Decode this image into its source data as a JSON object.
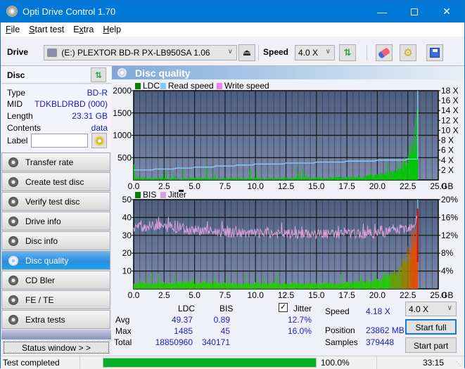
{
  "window": {
    "title": "Opti Drive Control 1.70",
    "controls": [
      "minimize",
      "maximize",
      "close"
    ]
  },
  "menu": [
    {
      "label": "File",
      "accel": "F"
    },
    {
      "label": "Start test",
      "accel": "S"
    },
    {
      "label": "Extra",
      "accel": "x"
    },
    {
      "label": "Help",
      "accel": "H"
    }
  ],
  "toolbar": {
    "drive_label": "Drive",
    "drive_value": "(E:)  PLEXTOR BD-R  PX-LB950SA 1.06",
    "speed_label": "Speed",
    "speed_value": "4.0 X",
    "icons": [
      "eject-icon",
      "refresh-icon",
      "eraser-icon",
      "settings-icon",
      "save-icon"
    ]
  },
  "disc": {
    "header": "Disc",
    "rows": [
      {
        "label": "Type",
        "value": "BD-R"
      },
      {
        "label": "MID",
        "value": "TDKBLDRBD (000)"
      },
      {
        "label": "Length",
        "value": "23.31 GB"
      },
      {
        "label": "Contents",
        "value": "data"
      }
    ],
    "label_field_label": "Label",
    "label_field_value": ""
  },
  "nav": [
    {
      "label": "Transfer rate",
      "active": false
    },
    {
      "label": "Create test disc",
      "active": false
    },
    {
      "label": "Verify test disc",
      "active": false
    },
    {
      "label": "Drive info",
      "active": false
    },
    {
      "label": "Disc info",
      "active": false
    },
    {
      "label": "Disc quality",
      "active": true
    },
    {
      "label": "CD Bler",
      "active": false
    },
    {
      "label": "FE / TE",
      "active": false
    },
    {
      "label": "Extra tests",
      "active": false
    }
  ],
  "status_window_button": "Status window > >",
  "panel_title": "Disc quality",
  "chart_data": [
    {
      "type": "area",
      "title": "",
      "legend": [
        "LDC",
        "Read speed",
        "Write speed"
      ],
      "legend_colors": [
        "#008000",
        "#80c8f8",
        "#f080f0"
      ],
      "legend_placement": "top-left",
      "xlabel": "GB",
      "ylabel": "",
      "xlim": [
        0,
        25
      ],
      "ylim": [
        0,
        2000
      ],
      "y2lim": [
        0,
        18
      ],
      "x_ticks": [
        "0.0",
        "2.5",
        "5.0",
        "7.5",
        "10.0",
        "12.5",
        "15.0",
        "17.5",
        "20.0",
        "22.5",
        "25.0"
      ],
      "y_ticks": [
        "500",
        "1000",
        "1500",
        "2000"
      ],
      "y2_ticks": [
        "2 X",
        "4 X",
        "6 X",
        "8 X",
        "10 X",
        "12 X",
        "14 X",
        "16 X",
        "18 X"
      ],
      "grid": true,
      "series": [
        {
          "name": "LDC",
          "x": [
            0,
            0.5,
            1,
            2,
            3,
            4,
            5,
            6,
            7,
            8,
            9,
            10,
            11,
            12,
            13,
            14,
            15,
            16,
            17,
            18,
            19,
            20,
            20.5,
            21,
            21.5,
            22,
            22.3,
            22.6,
            22.9,
            23.1,
            23.31
          ],
          "y": [
            60,
            45,
            40,
            38,
            36,
            38,
            40,
            36,
            35,
            36,
            38,
            40,
            38,
            40,
            42,
            45,
            48,
            50,
            55,
            62,
            75,
            100,
            130,
            170,
            220,
            300,
            420,
            600,
            850,
            1100,
            1485
          ]
        },
        {
          "name": "Read speed",
          "x": [
            0,
            1,
            2.5,
            5,
            7.5,
            10,
            12.5,
            15,
            17.5,
            20,
            22.5,
            23.31
          ],
          "y": [
            1.9,
            2.0,
            2.2,
            2.5,
            2.8,
            3.1,
            3.3,
            3.5,
            3.7,
            3.9,
            4.1,
            4.18
          ]
        }
      ]
    },
    {
      "type": "area",
      "title": "",
      "legend": [
        "BIS",
        "Jitter"
      ],
      "legend_colors": [
        "#008000",
        "#d8a0d8"
      ],
      "legend_placement": "top-left",
      "xlabel": "GB",
      "ylabel": "",
      "xlim": [
        0,
        25
      ],
      "ylim": [
        0,
        50
      ],
      "y2lim": [
        0,
        20
      ],
      "x_ticks": [
        "0.0",
        "2.5",
        "5.0",
        "7.5",
        "10.0",
        "12.5",
        "15.0",
        "17.5",
        "20.0",
        "22.5",
        "25.0"
      ],
      "y_ticks": [
        "10",
        "20",
        "30",
        "40",
        "50"
      ],
      "y2_ticks": [
        "4%",
        "8%",
        "12%",
        "16%",
        "20%"
      ],
      "grid": true,
      "series": [
        {
          "name": "BIS",
          "x": [
            0,
            2,
            4,
            6,
            8,
            10,
            12,
            14,
            16,
            18,
            19,
            20,
            20.5,
            21,
            21.5,
            22,
            22.3,
            22.6,
            22.9,
            23.1,
            23.31
          ],
          "y": [
            3,
            3,
            3.5,
            3.5,
            3,
            3,
            3,
            3,
            3,
            3.5,
            4,
            5,
            6,
            7,
            9,
            12,
            17,
            22,
            28,
            33,
            45
          ]
        },
        {
          "name": "Jitter",
          "x": [
            0,
            1,
            2,
            3,
            5,
            7.5,
            10,
            12.5,
            15,
            17.5,
            20,
            21,
            22,
            22.5,
            23,
            23.31
          ],
          "y": [
            13.8,
            14.0,
            14.2,
            13.6,
            13.2,
            12.6,
            12.4,
            12.3,
            12.3,
            12.3,
            12.4,
            12.8,
            13.3,
            13.8,
            14.4,
            16.0
          ]
        }
      ]
    }
  ],
  "stats": {
    "col_headers": [
      "LDC",
      "BIS"
    ],
    "rows": [
      {
        "label": "Avg",
        "ldc": "49.37",
        "bis": "0.89",
        "jitter": "12.7%"
      },
      {
        "label": "Max",
        "ldc": "1485",
        "bis": "45",
        "jitter": "16.0%"
      },
      {
        "label": "Total",
        "ldc": "18850960",
        "bis": "340171",
        "jitter": ""
      }
    ],
    "jitter_label": "Jitter",
    "jitter_checked": true,
    "speed_label": "Speed",
    "speed_value": "4.18 X",
    "position_label": "Position",
    "position_value": "23862 MB",
    "samples_label": "Samples",
    "samples_value": "379448",
    "speed_select": "4.0 X",
    "start_full": "Start full",
    "start_part": "Start part"
  },
  "statusbar": {
    "text": "Test completed",
    "progress": 100.0,
    "progress_text": "100.0%",
    "time": "33:15"
  }
}
